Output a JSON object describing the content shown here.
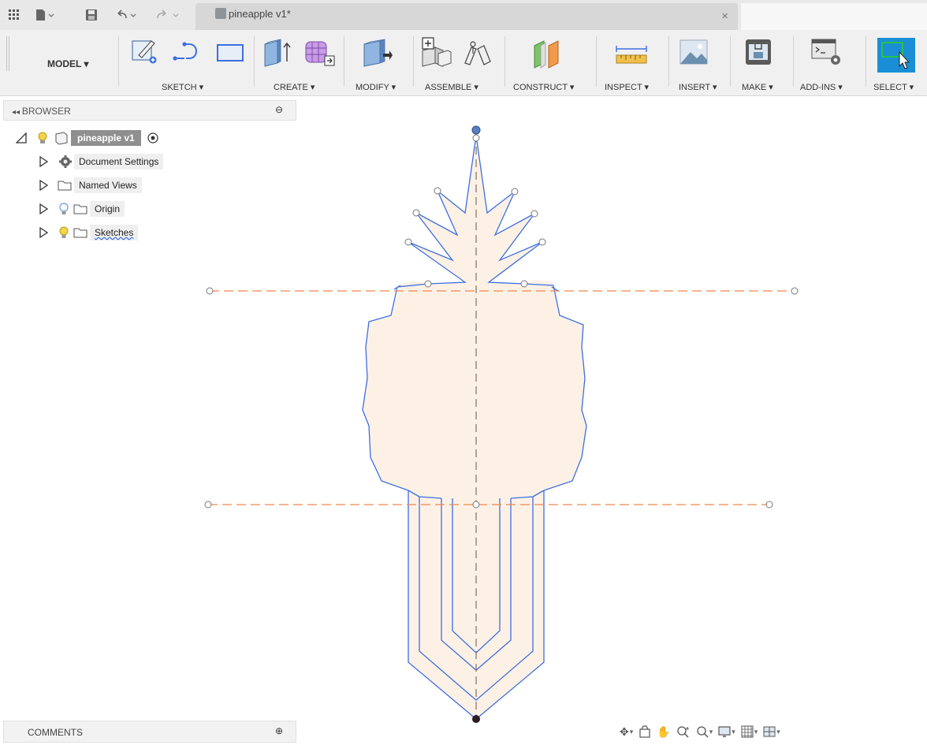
{
  "titlebar": {
    "icons": [
      "grid-icon",
      "file-icon",
      "save-icon",
      "undo-icon",
      "redo-icon"
    ],
    "tab_title": "pineapple v1*",
    "close_glyph": "×"
  },
  "toolbar": {
    "workspace_label": "MODEL ▾",
    "groups": {
      "sketch": "SKETCH ▾",
      "create": "CREATE ▾",
      "modify": "MODIFY ▾",
      "assemble": "ASSEMBLE ▾",
      "construct": "CONSTRUCT ▾",
      "inspect": "INSPECT ▾",
      "insert": "INSERT ▾",
      "make": "MAKE ▾",
      "addins": "ADD-INS ▾",
      "select": "SELECT ▾"
    }
  },
  "browser": {
    "title": "BROWSER",
    "root": "pineapple v1",
    "items": [
      {
        "label": "Document Settings",
        "icon": "gear-icon"
      },
      {
        "label": "Named Views",
        "icon": "folder-icon"
      },
      {
        "label": "Origin",
        "icon": "folder-icon"
      },
      {
        "label": "Sketches",
        "icon": "folder-icon"
      }
    ]
  },
  "comments": {
    "title": "COMMENTS"
  },
  "colors": {
    "accent_select": "#1a8fd6",
    "sketch_line": "#3d6fe0",
    "construction_line": "#f0874a",
    "profile_fill": "#fdf1e6",
    "axis_line": "#8a7a6a"
  }
}
